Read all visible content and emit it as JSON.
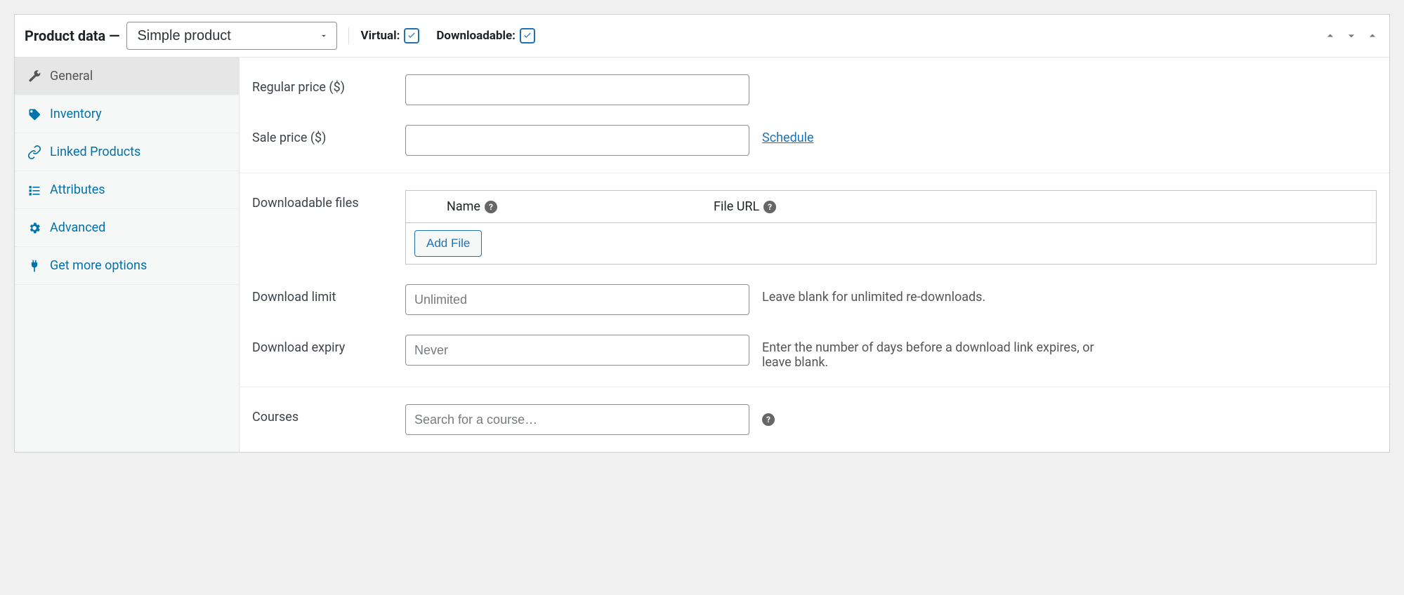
{
  "header": {
    "title": "Product data —",
    "product_type_selected": "Simple product",
    "virtual_label": "Virtual:",
    "virtual_checked": true,
    "downloadable_label": "Downloadable:",
    "downloadable_checked": true
  },
  "sidebar": {
    "tabs": [
      {
        "id": "general",
        "label": "General",
        "active": true
      },
      {
        "id": "inventory",
        "label": "Inventory",
        "active": false
      },
      {
        "id": "linked",
        "label": "Linked Products",
        "active": false
      },
      {
        "id": "attributes",
        "label": "Attributes",
        "active": false
      },
      {
        "id": "advanced",
        "label": "Advanced",
        "active": false
      },
      {
        "id": "more",
        "label": "Get more options",
        "active": false
      }
    ]
  },
  "form": {
    "regular_price_label": "Regular price ($)",
    "regular_price_value": "",
    "sale_price_label": "Sale price ($)",
    "sale_price_value": "",
    "schedule_link": "Schedule",
    "downloadable_files_label": "Downloadable files",
    "files_col_name": "Name",
    "files_col_url": "File URL",
    "add_file_button": "Add File",
    "download_limit_label": "Download limit",
    "download_limit_placeholder": "Unlimited",
    "download_limit_hint": "Leave blank for unlimited re-downloads.",
    "download_expiry_label": "Download expiry",
    "download_expiry_placeholder": "Never",
    "download_expiry_hint": "Enter the number of days before a download link expires, or leave blank.",
    "courses_label": "Courses",
    "courses_placeholder": "Search for a course…"
  },
  "help_tip_char": "?"
}
